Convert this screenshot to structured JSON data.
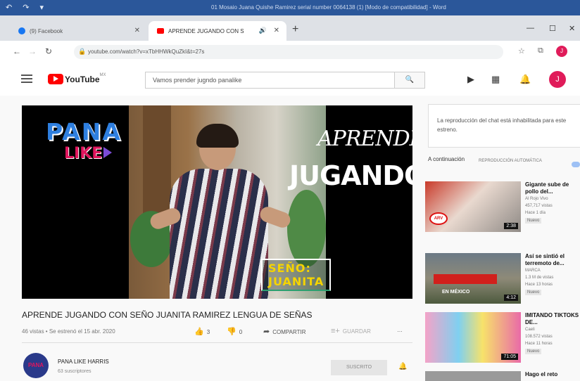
{
  "word_titlebar": {
    "quick_access": "↶ ↷ ▾",
    "doc_title": "01 Mosaio Juana Quishe Ramirez  serial number 0064138 (1) [Modo de compatibilidad]  -  Word"
  },
  "browser": {
    "tabs": [
      {
        "label": "(9) Facebook",
        "favicon_color": "#1877f2"
      },
      {
        "label": "APRENDE JUGANDO CON S",
        "favicon_color": "#ff0000"
      }
    ],
    "new_tab": "+",
    "window_controls": [
      "—",
      "☐",
      "✕"
    ],
    "url": "youtube.com/watch?v=xTbHHWkQuZkI&t=27s",
    "profile_letter": "J"
  },
  "youtube": {
    "logo_text": "YouTube",
    "country_code": "MX",
    "search_query": "Vamos prender jugndo panalike",
    "avatar_letter": "J"
  },
  "video": {
    "overlay_pana": "PANA",
    "overlay_like": "LIKE",
    "overlay_aprende": "APRENDE",
    "overlay_jugando": "JUGANDO",
    "overlay_name": "SEÑO: JUANITA",
    "title": "APRENDE JUGANDO CON SEÑO JUANITA RAMIREZ LENGUA DE SEÑAS",
    "meta": "46 vistas • Se estrenó el 15 abr. 2020",
    "likes": "3",
    "dislikes": "0",
    "share_label": "COMPARTIR",
    "save_label": "GUARDAR",
    "more_label": "…"
  },
  "channel": {
    "avatar_text": "PANA",
    "name": "PANA LIKE HARRIS",
    "subscribers": "63 suscriptores",
    "subscribe_label": "SUSCRITO"
  },
  "sidebar": {
    "chat_message": "La reproducción del chat está inhabilitada para este estreno.",
    "up_next": "A continuación",
    "autoplay": "REPRODUCCIÓN AUTOMÁTICA",
    "recommendations": [
      {
        "title": "Gigante sube de pollo del...",
        "channel": "Al Rojo Vivo",
        "views": "457,717 vistas",
        "time": "Hace 1 día",
        "badge": "Nuevo",
        "duration": "2:38",
        "theme": "red"
      },
      {
        "title": "Así se sintió el terremoto de...",
        "channel": "MARCA",
        "views": "1.3 M de vistas",
        "time": "Hace 13 horas",
        "badge": "Nuevo",
        "duration": "4:12",
        "theme": "street"
      },
      {
        "title": "IMITANDO TIKTOKS DE...",
        "channel": "Caeli",
        "views": "108.572 vistas",
        "time": "Hace 11 horas",
        "badge": "Nuevo",
        "duration": "71:05",
        "theme": "colorful"
      },
      {
        "title": "Hago el reto",
        "channel": "",
        "views": "",
        "time": "",
        "badge": "",
        "duration": "",
        "theme": "gray"
      }
    ]
  }
}
